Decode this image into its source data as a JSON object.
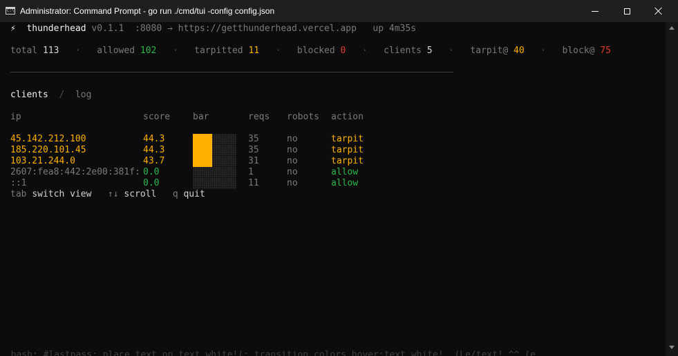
{
  "window": {
    "title": "Administrator: Command Prompt - go  run ./cmd/tui -config config.json",
    "icon_text": "C:\\"
  },
  "header": {
    "logo_glyph": "⚡",
    "app_name": "thunderhead",
    "version": "v0.1.1",
    "port": ":8080",
    "arrow": "→",
    "url": "https://getthunderhead.vercel.app",
    "uptime": "up 4m35s"
  },
  "stats": {
    "total_label": "total",
    "total": "113",
    "allowed_label": "allowed",
    "allowed": "102",
    "tarpitted_label": "tarpitted",
    "tarpitted": "11",
    "blocked_label": "blocked",
    "blocked": "0",
    "clients_label": "clients",
    "clients": "5",
    "tarpit_at_label": "tarpit@",
    "tarpit_at": "40",
    "block_at_label": "block@",
    "block_at": "75",
    "dot": "·"
  },
  "tabs": {
    "clients": "clients",
    "slash": "/",
    "log": "log"
  },
  "table": {
    "headers": {
      "ip": "ip",
      "score": "score",
      "bar": "bar",
      "reqs": "reqs",
      "robots": "robots",
      "action": "action"
    },
    "rows": [
      {
        "ip": "45.142.212.100",
        "score": "44.3",
        "score_value": 44.3,
        "reqs": "35",
        "robots": "no",
        "action": "tarpit"
      },
      {
        "ip": "185.220.101.45",
        "score": "44.3",
        "score_value": 44.3,
        "reqs": "35",
        "robots": "no",
        "action": "tarpit"
      },
      {
        "ip": "103.21.244.0",
        "score": "43.7",
        "score_value": 43.7,
        "reqs": "31",
        "robots": "no",
        "action": "tarpit"
      },
      {
        "ip": "2607:fea8:442:2e00:381f:",
        "score": "0.0",
        "score_value": 0.0,
        "reqs": "1",
        "robots": "no",
        "action": "allow"
      },
      {
        "ip": "::1",
        "score": "0.0",
        "score_value": 0.0,
        "reqs": "11",
        "robots": "no",
        "action": "allow"
      }
    ]
  },
  "help": {
    "tab_key": "tab",
    "tab_desc": "switch view",
    "scroll_key": "↑↓",
    "scroll_desc": "scroll",
    "quit_key": "q",
    "quit_desc": "quit"
  },
  "ghost_text": "  bash: #lastpass; place text on text white!(; transition colors hover:text white!  (Le/text! ^^ (e",
  "colors": {
    "tarpit": "#ffb000",
    "allow": "#2db84c",
    "block": "#e03a2e",
    "background": "#0c0c0c",
    "titlebar": "#1f1f1f"
  }
}
